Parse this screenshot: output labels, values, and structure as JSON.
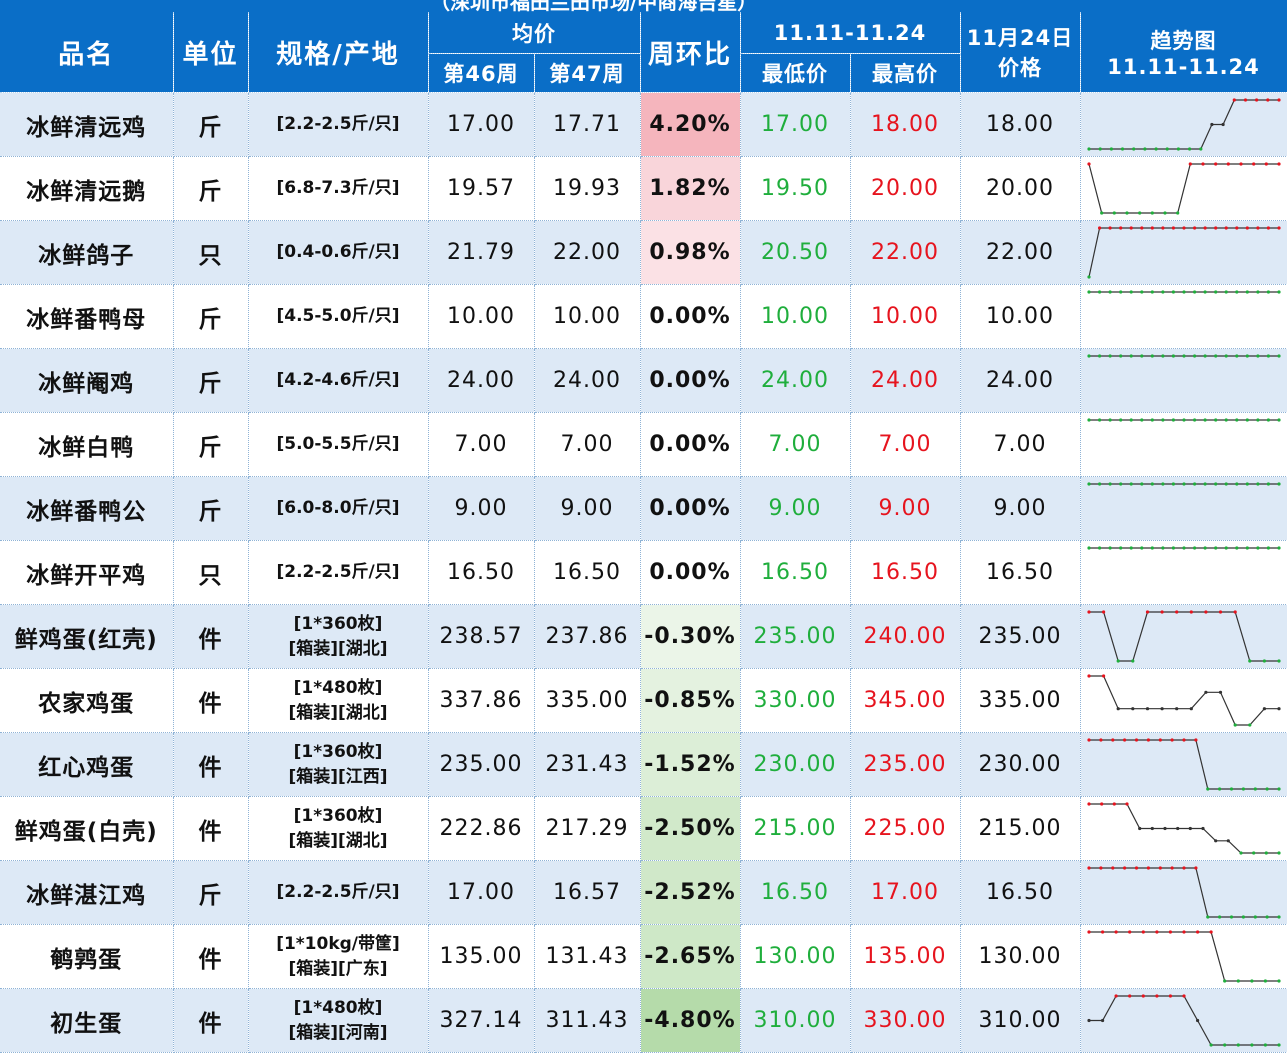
{
  "header": {
    "caption": "（深圳市福田兰田市场/中商海吉星）",
    "name": "品名",
    "unit": "单位",
    "spec": "规格/产地",
    "avg": "均价",
    "week46": "第46周",
    "week47": "第47周",
    "wow": "周环比",
    "range": "11.11-11.24",
    "low": "最低价",
    "high": "最高价",
    "price_day_line1": "11月24日",
    "price_day_line2": "价格",
    "trend_line1": "趋势图",
    "trend_line2": "11.11-11.24"
  },
  "colors": {
    "header_bg": "#0a6ec7",
    "stripe_bg": "#dde9f6",
    "low_price": "#1fae3c",
    "high_price": "#e6141e",
    "up_heat": "#f4b6be",
    "down_heat": "#a9d59a"
  },
  "rows": [
    {
      "name": "冰鲜清远鸡",
      "unit": "斤",
      "spec": [
        "[2.2-2.5斤/只]"
      ],
      "w46": "17.00",
      "w47": "17.71",
      "change": "4.20%",
      "change_pct": 4.2,
      "low": "17.00",
      "high": "18.00",
      "price": "18.00",
      "trend": [
        17,
        17,
        17,
        17,
        17,
        17,
        17,
        17,
        17,
        17,
        17,
        17.5,
        17.5,
        18,
        18,
        18,
        18,
        18
      ]
    },
    {
      "name": "冰鲜清远鹅",
      "unit": "斤",
      "spec": [
        "[6.8-7.3斤/只]"
      ],
      "w46": "19.57",
      "w47": "19.93",
      "change": "1.82%",
      "change_pct": 1.82,
      "low": "19.50",
      "high": "20.00",
      "price": "20.00",
      "trend": [
        20,
        19.5,
        19.5,
        19.5,
        19.5,
        19.5,
        19.5,
        19.5,
        20,
        20,
        20,
        20,
        20,
        20,
        20,
        20
      ]
    },
    {
      "name": "冰鲜鸽子",
      "unit": "只",
      "spec": [
        "[0.4-0.6斤/只]"
      ],
      "w46": "21.79",
      "w47": "22.00",
      "change": "0.98%",
      "change_pct": 0.98,
      "low": "20.50",
      "high": "22.00",
      "price": "22.00",
      "trend": [
        20.5,
        22,
        22,
        22,
        22,
        22,
        22,
        22,
        22,
        22,
        22,
        22,
        22,
        22,
        22,
        22,
        22,
        22,
        22
      ]
    },
    {
      "name": "冰鲜番鸭母",
      "unit": "斤",
      "spec": [
        "[4.5-5.0斤/只]"
      ],
      "w46": "10.00",
      "w47": "10.00",
      "change": "0.00%",
      "change_pct": 0.0,
      "low": "10.00",
      "high": "10.00",
      "price": "10.00",
      "trend": [
        10,
        10,
        10,
        10,
        10,
        10,
        10,
        10,
        10,
        10,
        10,
        10,
        10,
        10,
        10,
        10,
        10,
        10,
        10
      ]
    },
    {
      "name": "冰鲜阉鸡",
      "unit": "斤",
      "spec": [
        "[4.2-4.6斤/只]"
      ],
      "w46": "24.00",
      "w47": "24.00",
      "change": "0.00%",
      "change_pct": 0.0,
      "low": "24.00",
      "high": "24.00",
      "price": "24.00",
      "trend": [
        24,
        24,
        24,
        24,
        24,
        24,
        24,
        24,
        24,
        24,
        24,
        24,
        24,
        24,
        24,
        24,
        24,
        24,
        24
      ]
    },
    {
      "name": "冰鲜白鸭",
      "unit": "斤",
      "spec": [
        "[5.0-5.5斤/只]"
      ],
      "w46": "7.00",
      "w47": "7.00",
      "change": "0.00%",
      "change_pct": 0.0,
      "low": "7.00",
      "high": "7.00",
      "price": "7.00",
      "trend": [
        7,
        7,
        7,
        7,
        7,
        7,
        7,
        7,
        7,
        7,
        7,
        7,
        7,
        7,
        7,
        7,
        7,
        7,
        7
      ]
    },
    {
      "name": "冰鲜番鸭公",
      "unit": "斤",
      "spec": [
        "[6.0-8.0斤/只]"
      ],
      "w46": "9.00",
      "w47": "9.00",
      "change": "0.00%",
      "change_pct": 0.0,
      "low": "9.00",
      "high": "9.00",
      "price": "9.00",
      "trend": [
        9,
        9,
        9,
        9,
        9,
        9,
        9,
        9,
        9,
        9,
        9,
        9,
        9,
        9,
        9,
        9,
        9,
        9,
        9
      ]
    },
    {
      "name": "冰鲜开平鸡",
      "unit": "只",
      "spec": [
        "[2.2-2.5斤/只]"
      ],
      "w46": "16.50",
      "w47": "16.50",
      "change": "0.00%",
      "change_pct": 0.0,
      "low": "16.50",
      "high": "16.50",
      "price": "16.50",
      "trend": [
        16.5,
        16.5,
        16.5,
        16.5,
        16.5,
        16.5,
        16.5,
        16.5,
        16.5,
        16.5,
        16.5,
        16.5,
        16.5,
        16.5,
        16.5,
        16.5,
        16.5,
        16.5,
        16.5
      ]
    },
    {
      "name": "鲜鸡蛋(红壳)",
      "unit": "件",
      "spec": [
        "[1*360枚]",
        "[箱装][湖北]"
      ],
      "w46": "238.57",
      "w47": "237.86",
      "change": "-0.30%",
      "change_pct": -0.3,
      "low": "235.00",
      "high": "240.00",
      "price": "235.00",
      "trend": [
        240,
        240,
        235,
        235,
        240,
        240,
        240,
        240,
        240,
        240,
        240,
        235,
        235,
        235
      ]
    },
    {
      "name": "农家鸡蛋",
      "unit": "件",
      "spec": [
        "[1*480枚]",
        "[箱装][湖北]"
      ],
      "w46": "337.86",
      "w47": "335.00",
      "change": "-0.85%",
      "change_pct": -0.85,
      "low": "330.00",
      "high": "345.00",
      "price": "335.00",
      "trend": [
        345,
        345,
        335,
        335,
        335,
        335,
        335,
        335,
        340,
        340,
        330,
        330,
        335,
        335
      ]
    },
    {
      "name": "红心鸡蛋",
      "unit": "件",
      "spec": [
        "[1*360枚]",
        "[箱装][江西]"
      ],
      "w46": "235.00",
      "w47": "231.43",
      "change": "-1.52%",
      "change_pct": -1.52,
      "low": "230.00",
      "high": "235.00",
      "price": "230.00",
      "trend": [
        235,
        235,
        235,
        235,
        235,
        235,
        235,
        235,
        235,
        235,
        230,
        230,
        230,
        230,
        230,
        230,
        230
      ]
    },
    {
      "name": "鲜鸡蛋(白壳)",
      "unit": "件",
      "spec": [
        "[1*360枚]",
        "[箱装][湖北]"
      ],
      "w46": "222.86",
      "w47": "217.29",
      "change": "-2.50%",
      "change_pct": -2.5,
      "low": "215.00",
      "high": "225.00",
      "price": "215.00",
      "trend": [
        225,
        225,
        225,
        225,
        220,
        220,
        220,
        220,
        220,
        220,
        217.5,
        217.5,
        215,
        215,
        215,
        215
      ]
    },
    {
      "name": "冰鲜湛江鸡",
      "unit": "斤",
      "spec": [
        "[2.2-2.5斤/只]"
      ],
      "w46": "17.00",
      "w47": "16.57",
      "change": "-2.52%",
      "change_pct": -2.52,
      "low": "16.50",
      "high": "17.00",
      "price": "16.50",
      "trend": [
        17,
        17,
        17,
        17,
        17,
        17,
        17,
        17,
        17,
        17,
        16.5,
        16.5,
        16.5,
        16.5,
        16.5,
        16.5,
        16.5
      ]
    },
    {
      "name": "鹌鹑蛋",
      "unit": "件",
      "spec": [
        "[1*10kg/带筐]",
        "[箱装][广东]"
      ],
      "w46": "135.00",
      "w47": "131.43",
      "change": "-2.65%",
      "change_pct": -2.65,
      "low": "130.00",
      "high": "135.00",
      "price": "130.00",
      "trend": [
        135,
        135,
        135,
        135,
        135,
        135,
        135,
        135,
        135,
        135,
        130,
        130,
        130,
        130,
        130
      ]
    },
    {
      "name": "初生蛋",
      "unit": "件",
      "spec": [
        "[1*480枚]",
        "[箱装][河南]"
      ],
      "w46": "327.14",
      "w47": "311.43",
      "change": "-4.80%",
      "change_pct": -4.8,
      "low": "310.00",
      "high": "330.00",
      "price": "310.00",
      "trend": [
        320,
        320,
        330,
        330,
        330,
        330,
        330,
        330,
        320,
        310,
        310,
        310,
        310,
        310,
        310
      ]
    }
  ]
}
